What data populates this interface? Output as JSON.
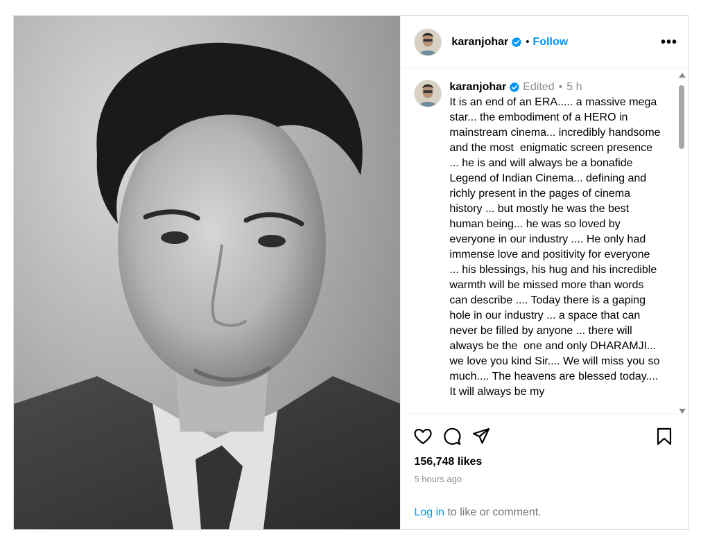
{
  "post": {
    "username": "karanjohar",
    "follow_label": "Follow",
    "more_label": "•••",
    "separator": "•"
  },
  "caption": {
    "username": "karanjohar",
    "edited": "Edited",
    "separator": "•",
    "age": "5 h",
    "text": "It is an end of an ERA..... a massive mega star... the embodiment of a HERO in mainstream cinema... incredibly handsome and the most  enigmatic screen presence ... he is and will always be a bonafide Legend of Indian Cinema... defining and richly present in the pages of cinema history ... but mostly he was the best human being... he was so loved by everyone in our industry .... He only had immense love and positivity for everyone ... his blessings, his hug and his incredible warmth will be missed more than words can describe .... Today there is a gaping hole in our industry ... a space that can never be filled by anyone ... there will always be the  one and only DHARAMJI... we love you kind Sir.... We will miss you so much.... The heavens are blessed today.... It will always be my"
  },
  "stats": {
    "likes": "156,748 likes",
    "posted": "5 hours ago"
  },
  "footer": {
    "login_link": "Log in",
    "login_rest": " to like or comment."
  },
  "icons": {
    "like": "heart-icon",
    "comment": "comment-icon",
    "share": "share-icon",
    "save": "bookmark-icon",
    "verified": "verified-badge-icon"
  },
  "colors": {
    "accent": "#0095f6",
    "muted": "#8e8e8e",
    "border": "#dbdbdb"
  }
}
